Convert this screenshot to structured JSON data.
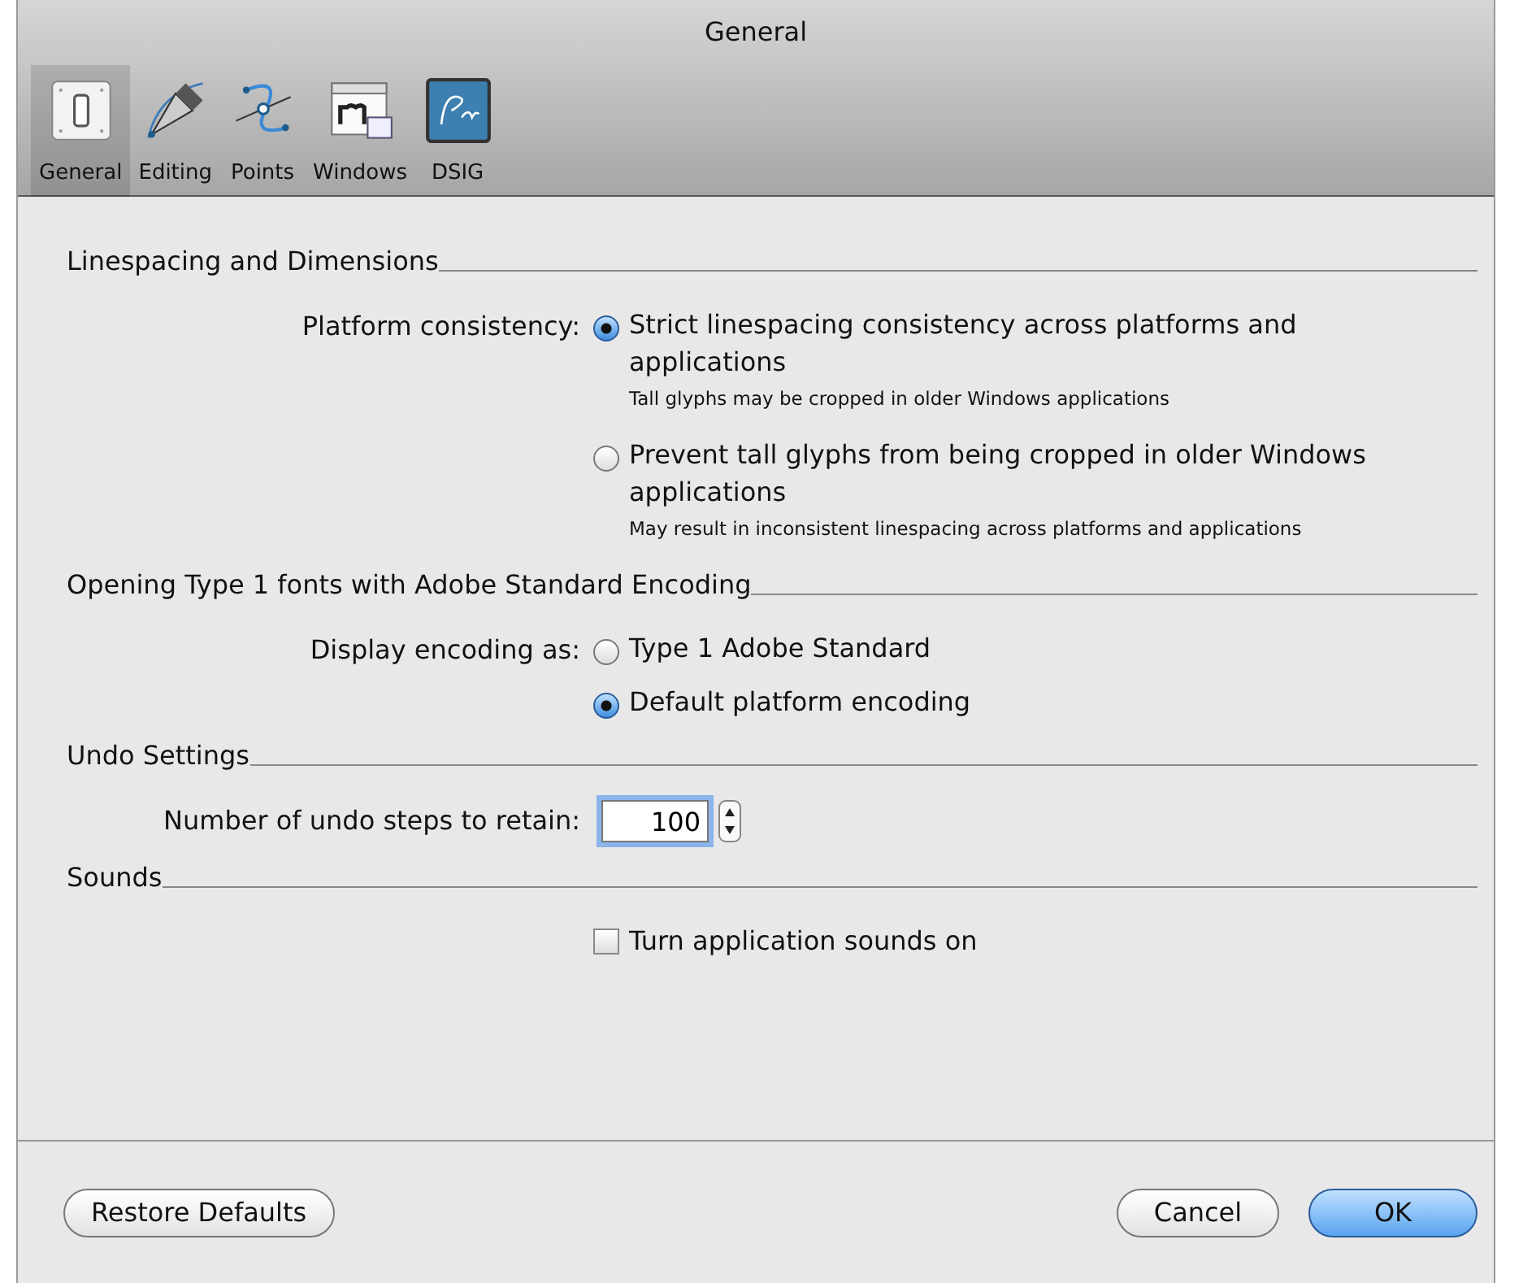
{
  "window": {
    "title": "General"
  },
  "toolbar": [
    {
      "label": "General",
      "kind": "switch",
      "selected": true
    },
    {
      "label": "Editing",
      "kind": "pen",
      "selected": false
    },
    {
      "label": "Points",
      "kind": "curve",
      "selected": false
    },
    {
      "label": "Windows",
      "kind": "windows",
      "selected": false
    },
    {
      "label": "DSIG",
      "kind": "signature",
      "selected": false
    }
  ],
  "sections": [
    {
      "heading": "Linespacing and Dimensions",
      "kind": "radio",
      "label": "Platform consistency:",
      "options": [
        {
          "text": "Strict linespacing consistency across platforms and applications",
          "note": "Tall glyphs may be cropped in older Windows applications",
          "selected": true
        },
        {
          "text": "Prevent tall glyphs from being cropped in older Windows applications",
          "note": "May result in inconsistent linespacing across platforms and applications",
          "selected": false
        }
      ]
    },
    {
      "heading": "Opening Type 1 fonts with Adobe Standard Encoding",
      "kind": "radio",
      "label": "Display encoding as:",
      "options": [
        {
          "text": "Type 1 Adobe Standard",
          "selected": false
        },
        {
          "text": "Default platform encoding",
          "selected": true
        }
      ]
    },
    {
      "heading": "Undo Settings",
      "kind": "stepper",
      "label": "Number of undo steps to retain:",
      "value": "100"
    },
    {
      "heading": "Sounds",
      "kind": "checkbox",
      "label": "Turn application sounds on",
      "checked": false
    }
  ],
  "buttons": [
    {
      "label": "Restore Defaults",
      "kind": "plain"
    },
    {
      "label": "Cancel",
      "kind": "plain"
    },
    {
      "label": "OK",
      "kind": "default"
    }
  ]
}
